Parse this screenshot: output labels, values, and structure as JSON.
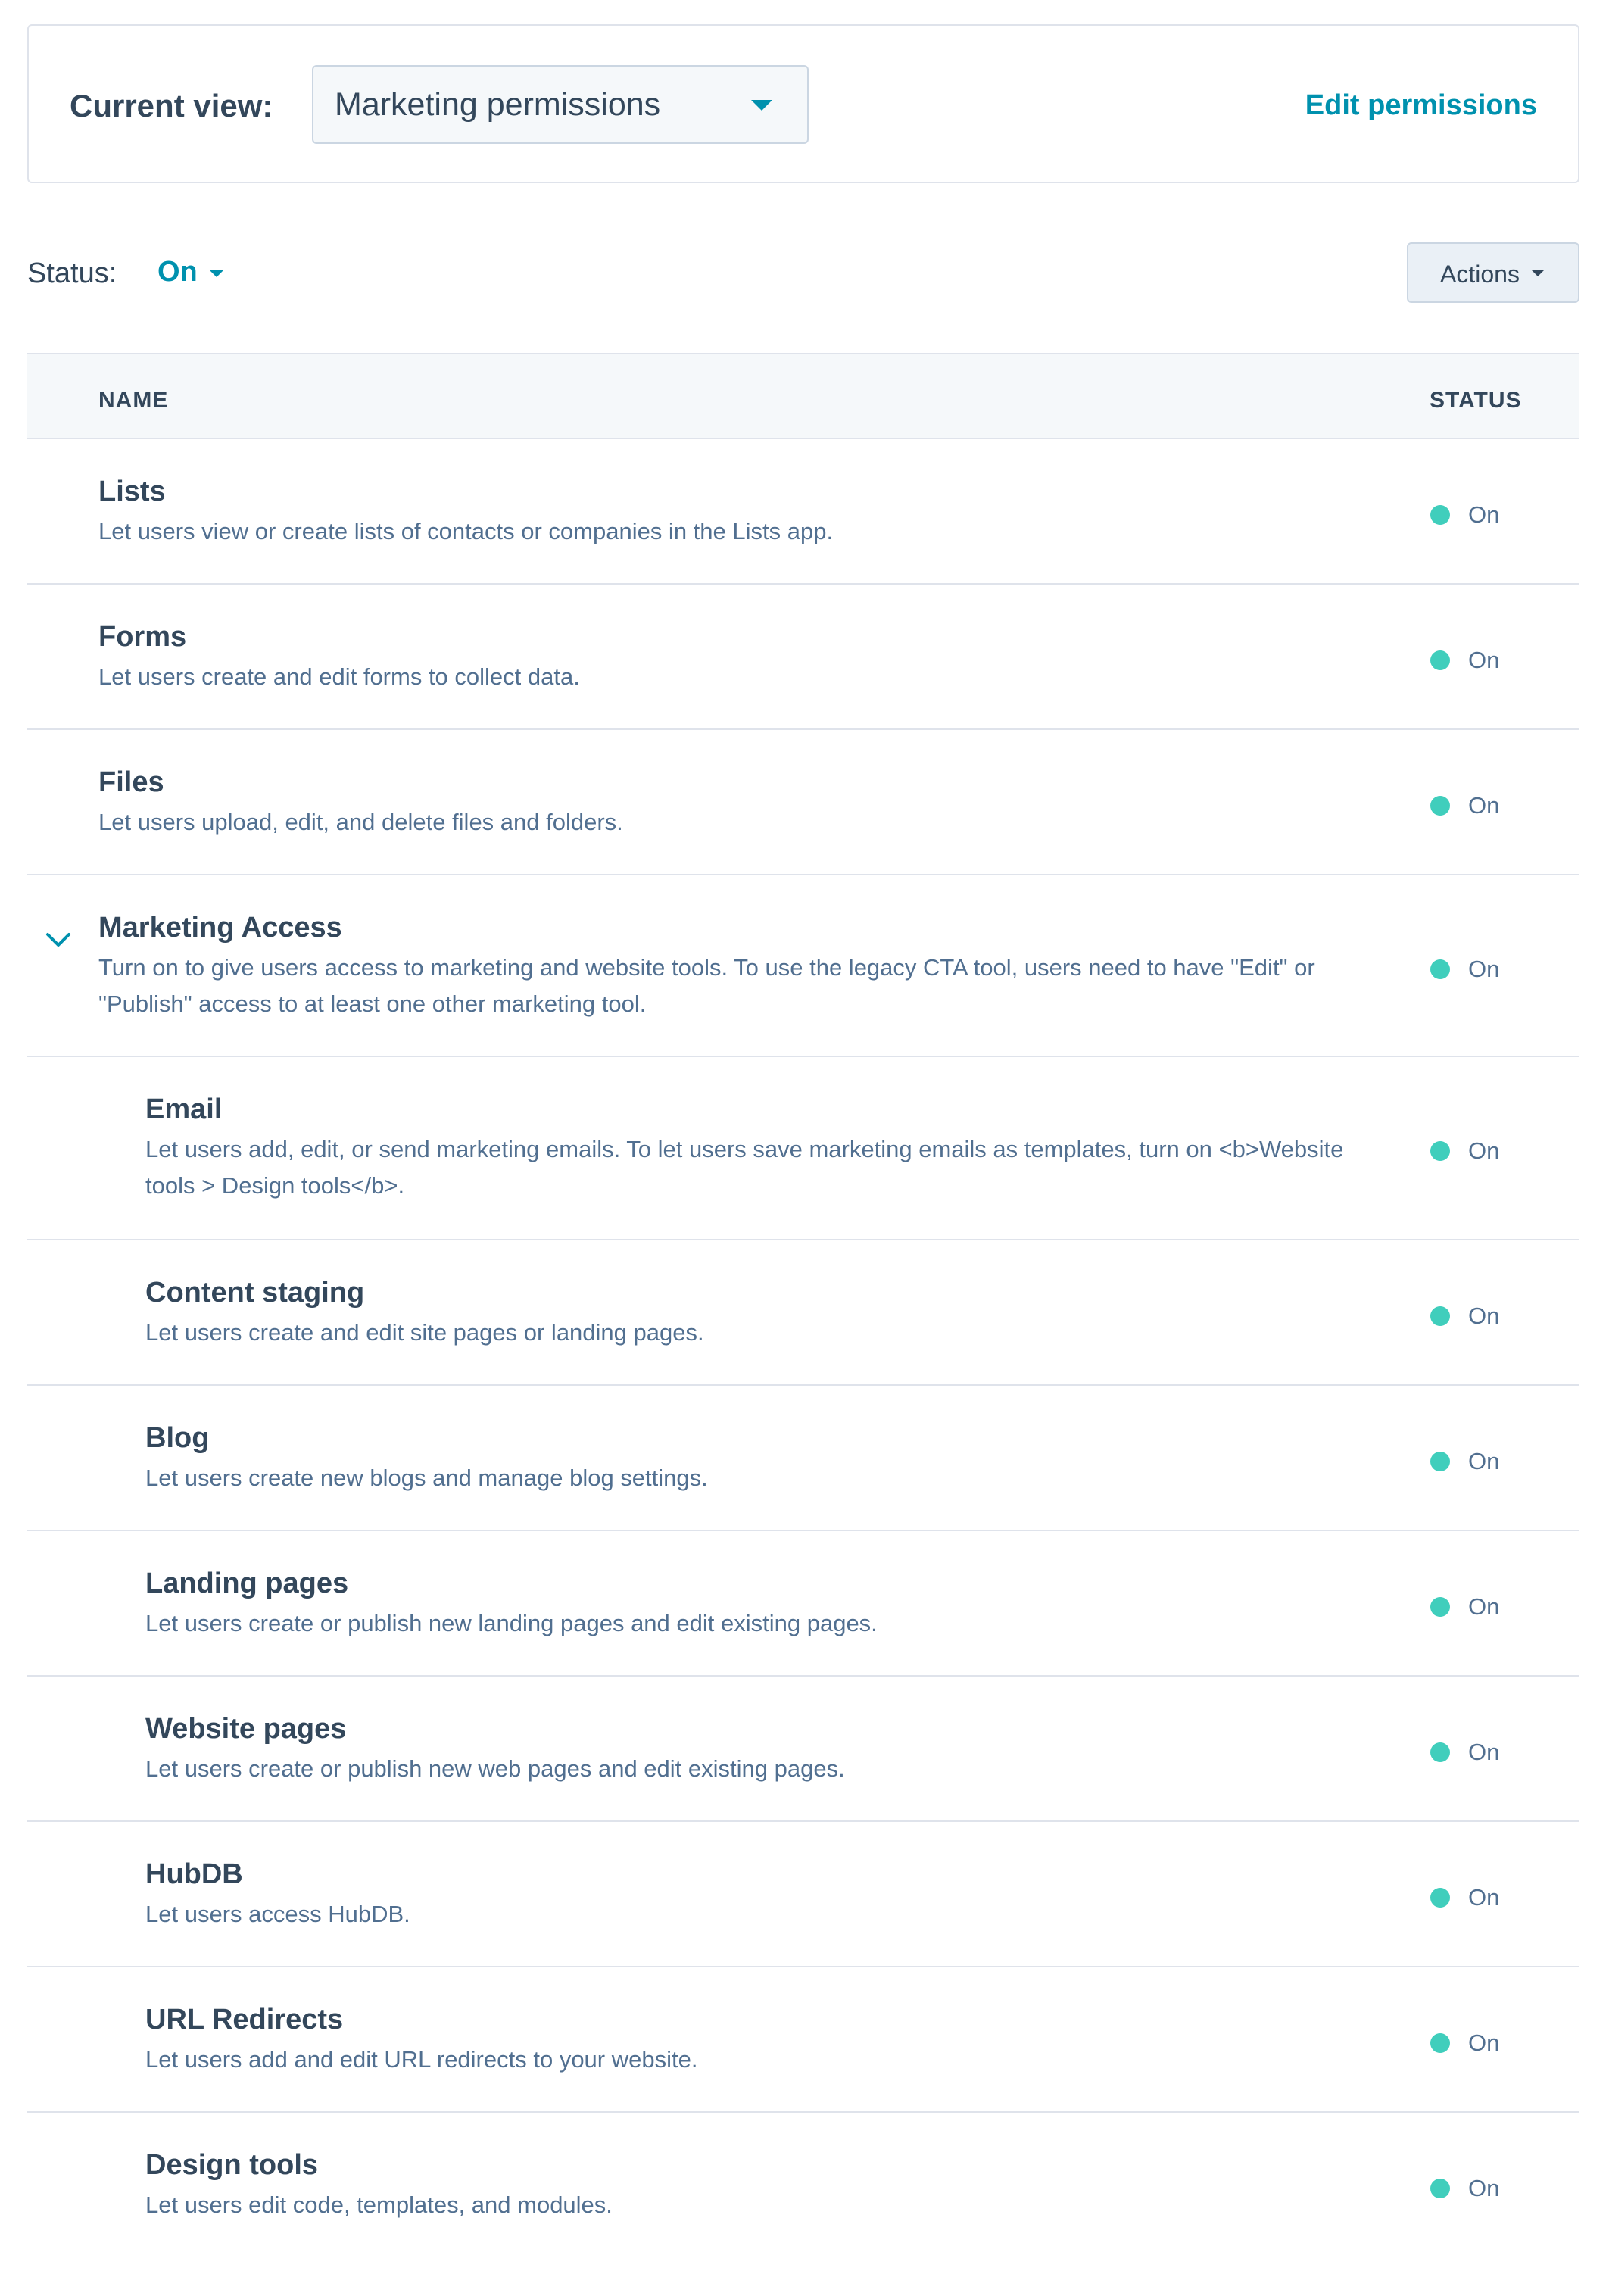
{
  "header": {
    "current_view_label": "Current view:",
    "view_select_value": "Marketing permissions",
    "edit_permissions_label": "Edit permissions"
  },
  "filter": {
    "status_label": "Status:",
    "status_value": "On",
    "actions_label": "Actions"
  },
  "table": {
    "columns": {
      "name": "NAME",
      "status": "STATUS"
    },
    "rows": [
      {
        "title": "Lists",
        "description": "Let users view or create lists of contacts or companies in the Lists app.",
        "status": "On"
      },
      {
        "title": "Forms",
        "description": "Let users create and edit forms to collect data.",
        "status": "On"
      },
      {
        "title": "Files",
        "description": "Let users upload, edit, and delete files and folders.",
        "status": "On"
      },
      {
        "title": "Marketing Access",
        "description": "Turn on to give users access to marketing and website tools. To use the legacy CTA tool, users need to have \"Edit\" or \"Publish\" access to at least one other marketing tool.",
        "status": "On"
      },
      {
        "title": "Email",
        "description": "Let users add, edit, or send marketing emails. To let users save marketing emails as templates, turn on <b>Website tools > Design tools</b>.",
        "status": "On"
      },
      {
        "title": "Content staging",
        "description": "Let users create and edit site pages or landing pages.",
        "status": "On"
      },
      {
        "title": "Blog",
        "description": "Let users create new blogs and manage blog settings.",
        "status": "On"
      },
      {
        "title": "Landing pages",
        "description": "Let users create or publish new landing pages and edit existing pages.",
        "status": "On"
      },
      {
        "title": "Website pages",
        "description": "Let users create or publish new web pages and edit existing pages.",
        "status": "On"
      },
      {
        "title": "HubDB",
        "description": "Let users access HubDB.",
        "status": "On"
      },
      {
        "title": "URL Redirects",
        "description": "Let users add and edit URL redirects to your website.",
        "status": "On"
      },
      {
        "title": "Design tools",
        "description": "Let users edit code, templates, and modules.",
        "status": "On"
      }
    ]
  },
  "colors": {
    "accent": "#0091ae",
    "status_on": "#00bda5",
    "text": "#33475b",
    "muted": "#516f90",
    "border": "#dfe3eb"
  },
  "icons": {
    "view_select_caret": "caret-down-icon",
    "expand_toggle": "chevron-down-icon",
    "status_indicator": "status-dot-icon"
  }
}
